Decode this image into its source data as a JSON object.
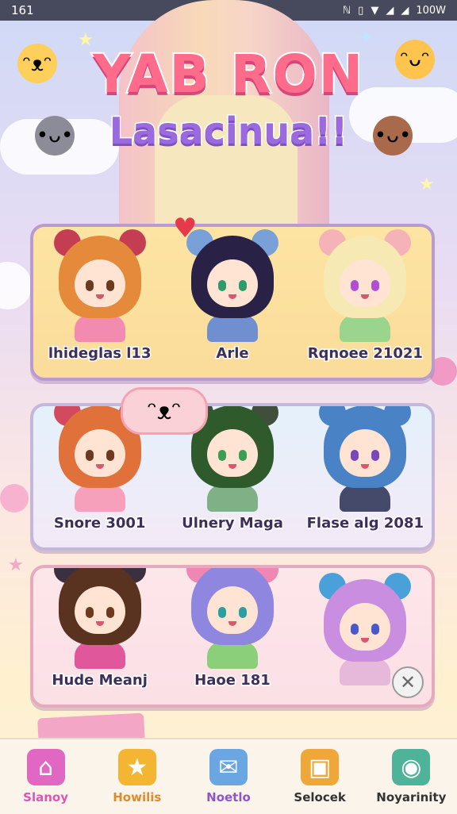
{
  "status_bar": {
    "time": "161",
    "battery": "100W",
    "icons": [
      "nfc-icon",
      "vibrate-icon",
      "wifi-icon",
      "signal-icon",
      "signal-icon"
    ]
  },
  "title": {
    "main": "YAB RON",
    "sub": "Lasacinua!!"
  },
  "panels": [
    {
      "characters": [
        {
          "name": "lhideglas l13",
          "hair": "#e58a3b",
          "eyes": "#6b3a1f",
          "ears": "#c43d52",
          "top": "#f38bb0"
        },
        {
          "name": "Arle",
          "hair": "#2a2146",
          "eyes": "#2c9c6a",
          "ears": "#7aa0d8",
          "top": "#6f8fd0"
        },
        {
          "name": "Rqnoee 21021",
          "hair": "#f6e9b3",
          "eyes": "#b04fcf",
          "ears": "#f5b3b8",
          "top": "#9bd48d"
        }
      ]
    },
    {
      "characters": [
        {
          "name": "Snore 3001",
          "hair": "#e0713a",
          "eyes": "#6b3a1f",
          "ears": "#d34a5f",
          "top": "#f6a0bb"
        },
        {
          "name": "Ulnery Maga",
          "hair": "#2f5a2c",
          "eyes": "#3b9e52",
          "ears": "#404e3b",
          "top": "#7fb086"
        },
        {
          "name": "Flase alg 2081",
          "hair": "#4a82c6",
          "eyes": "#7b46b8",
          "ears": "#4a82c6",
          "top": "#464a6a"
        }
      ]
    },
    {
      "characters": [
        {
          "name": "Hude Meanj",
          "hair": "#5a3220",
          "eyes": "#6b3a1f",
          "ears": "#3a3040",
          "top": "#e0579b"
        },
        {
          "name": "Haoe 181",
          "hair": "#8e86df",
          "eyes": "#2aa0a0",
          "ears": "#ef86b4",
          "top": "#8ccf7a"
        },
        {
          "name": "",
          "hair": "#c98ee0",
          "eyes": "#4a58c9",
          "ears": "#4aa0d8",
          "top": "#e6b8d9"
        }
      ]
    }
  ],
  "nav": [
    {
      "label": "Slanoy",
      "icon": "house-icon",
      "color": "#e055b3",
      "bg": "#e067c2"
    },
    {
      "label": "Howilis",
      "icon": "star-icon",
      "color": "#e08a2a",
      "bg": "#f4b533"
    },
    {
      "label": "Noetlo",
      "icon": "chat-icon",
      "color": "#8a57c9",
      "bg": "#6aa6e2"
    },
    {
      "label": "Selocek",
      "icon": "frame-icon",
      "color": "#333333",
      "bg": "#f0a73a"
    },
    {
      "label": "Noyarinity",
      "icon": "location-icon",
      "color": "#333333",
      "bg": "#4fb39a"
    }
  ]
}
